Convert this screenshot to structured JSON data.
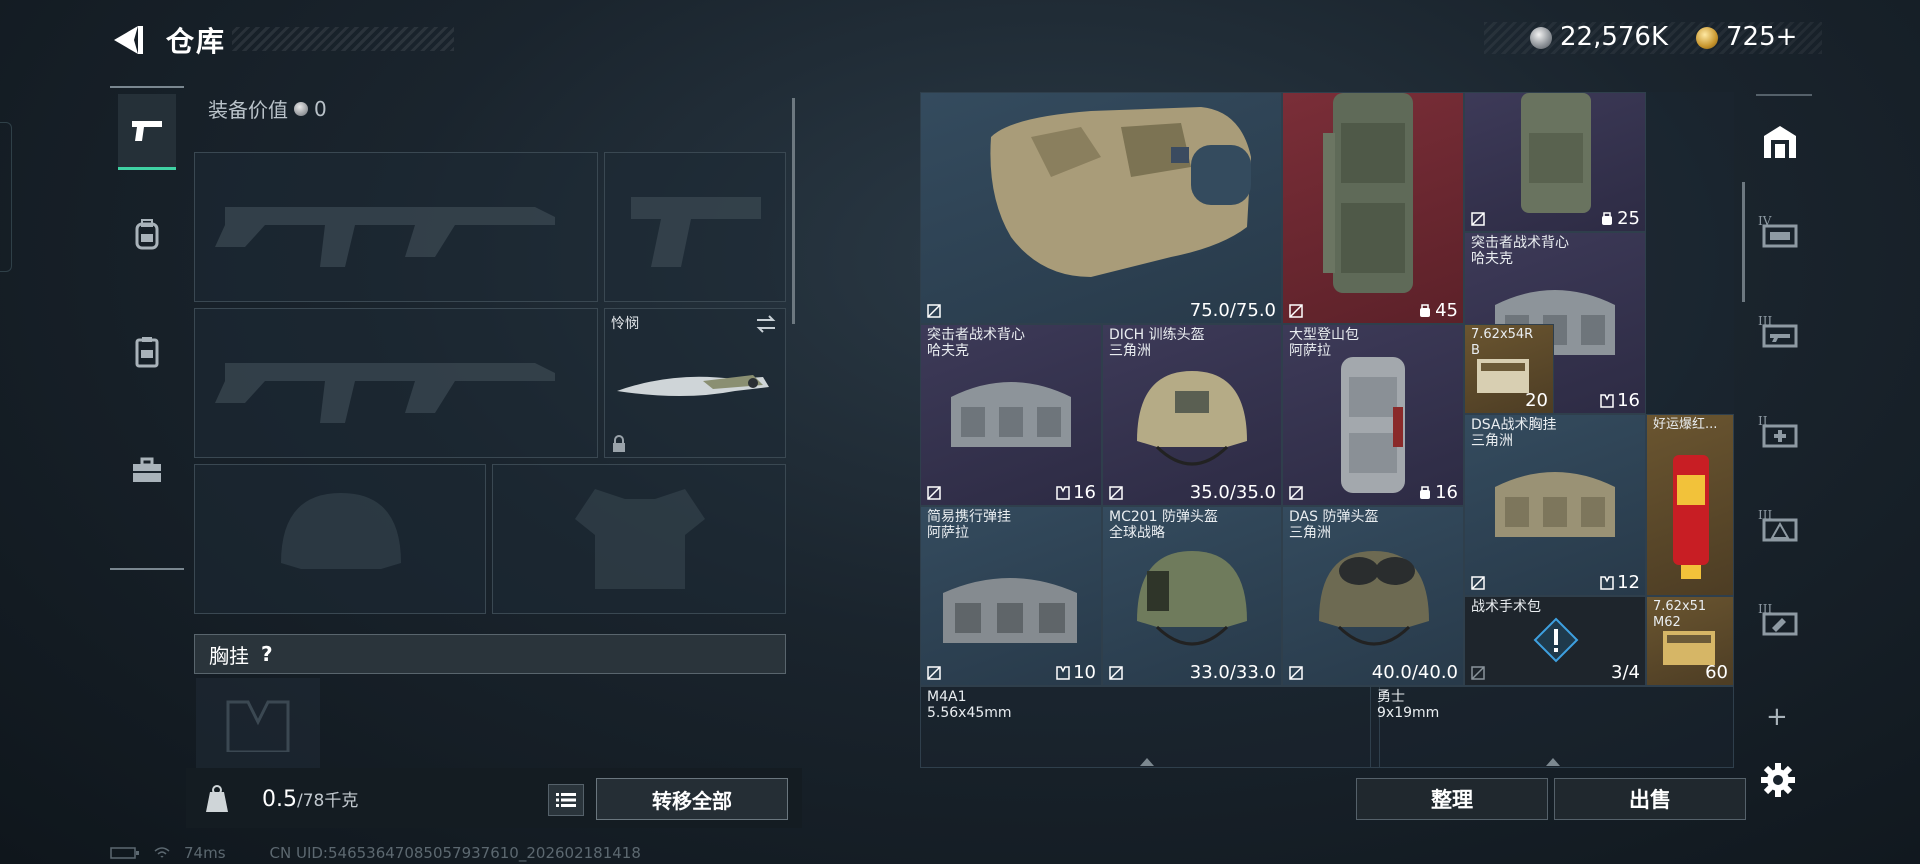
{
  "header": {
    "title": "仓库",
    "currency_silver": "22,576K",
    "currency_gold": "725+"
  },
  "left_nav": {
    "items": [
      "pistol-icon",
      "backpack-icon",
      "vest-icon",
      "toolbox-icon"
    ],
    "active": 0
  },
  "loadout": {
    "equip_value_label": "装备价值",
    "equip_value": "0",
    "knife_name": "怜悯",
    "chest_rig_label": "胸挂",
    "chest_rig_help": "?",
    "weight_current": "0.5",
    "weight_capacity": "/78千克",
    "transfer_all_label": "转移全部"
  },
  "stash": {
    "items": [
      {
        "id": "vest-armor",
        "name": "",
        "value": "75.0/75.0",
        "color": "blue"
      },
      {
        "id": "backpack-red",
        "name": "",
        "count": "45",
        "color": "red"
      },
      {
        "id": "vest-top-right",
        "name": "",
        "count": "25",
        "color": "purple"
      },
      {
        "id": "raider-vest-2",
        "name": "突击者战术背心\n哈夫克",
        "count": "16",
        "color": "purple"
      },
      {
        "id": "raider-vest-1",
        "name": "突击者战术背心\n哈夫克",
        "count": "16",
        "color": "purple"
      },
      {
        "id": "dich-helmet",
        "name": "DICH 训练头盔\n三角洲",
        "value": "35.0/35.0",
        "color": "purple"
      },
      {
        "id": "hiking-bag",
        "name": "大型登山包\n阿萨拉",
        "count": "16",
        "color": "purple"
      },
      {
        "id": "ammo-762-54",
        "name": "7.62x54R\nB",
        "count": "20",
        "color": "gold"
      },
      {
        "id": "dsa-rig",
        "name": "DSA战术胸挂\n三角洲",
        "count": "12",
        "color": "blue"
      },
      {
        "id": "lucky-firecracker",
        "name": "好运爆红...",
        "color": "gold"
      },
      {
        "id": "simple-rig",
        "name": "简易携行弹挂\n阿萨拉",
        "count": "10",
        "color": "blue"
      },
      {
        "id": "mc201-helmet",
        "name": "MC201 防弹头盔\n全球战略",
        "value": "33.0/33.0",
        "color": "blue"
      },
      {
        "id": "das-helmet",
        "name": "DAS 防弹头盔\n三角洲",
        "value": "40.0/40.0",
        "color": "blue"
      },
      {
        "id": "surgery-kit",
        "name": "战术手术包",
        "count": "3/4",
        "color": "dark"
      },
      {
        "id": "ammo-762-51",
        "name": "7.62x51\nM62",
        "count": "60",
        "color": "gold"
      },
      {
        "id": "ammo-m4a1",
        "name": "M4A1\n5.56x45mm",
        "color": "none"
      },
      {
        "id": "ammo-warrior",
        "name": "勇士\n9x19mm",
        "color": "none"
      }
    ]
  },
  "right_rail": {
    "items": [
      {
        "icon": "stash-home-icon",
        "roman": ""
      },
      {
        "icon": "case-icon",
        "roman": "IV"
      },
      {
        "icon": "gun-case-icon",
        "roman": "III"
      },
      {
        "icon": "medical-case-icon",
        "roman": "II"
      },
      {
        "icon": "armor-case-icon",
        "roman": "III"
      },
      {
        "icon": "tool-case-icon",
        "roman": "III"
      }
    ],
    "add_label": "+"
  },
  "actions": {
    "sort_label": "整理",
    "sell_label": "出售"
  },
  "status": {
    "ping": "74ms",
    "uid": "CN UID:54653647085057937610_202602181418"
  },
  "colors": {
    "accent": "#3fd1a3",
    "cell_blue": "#344b5e",
    "cell_purple": "#3d3a58",
    "cell_red": "#7a2e38",
    "cell_gold": "#6a5530"
  }
}
